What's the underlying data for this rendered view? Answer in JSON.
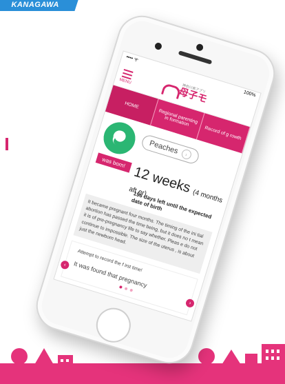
{
  "corner_tag": "KANAGAWA",
  "status": {
    "signal": "•••• ᯤ",
    "battery": "100%"
  },
  "app": {
    "menu_label": "MENU",
    "logo_text": "母子モ",
    "logo_sub": "神奈川県アプリ"
  },
  "tabs": [
    {
      "label": "HOME"
    },
    {
      "label": "Regional parenting in formation"
    },
    {
      "label": "Record of g rowth"
    }
  ],
  "baby": {
    "name": "Peaches",
    "born_button": "was born!",
    "weeks_main": "12 weeks",
    "weeks_sub": "(4 months aft er)",
    "days_left": "196 days left until the expected date of birth"
  },
  "message": "It became pregnant four months. The timing of the ini tial abortion has passed the time being, but it does no t mean it is of pre-pregnancy life to say whether. Pleas e do not continue to impossible. The size of the uterus , is about just the newborn head.",
  "card": {
    "line1": "Attempt to record the f irst time!",
    "line2": "It was found that pregnancy"
  },
  "colors": {
    "brand": "#d6266e",
    "accent_green": "#2bb673",
    "tag_blue": "#2a8fd8"
  }
}
